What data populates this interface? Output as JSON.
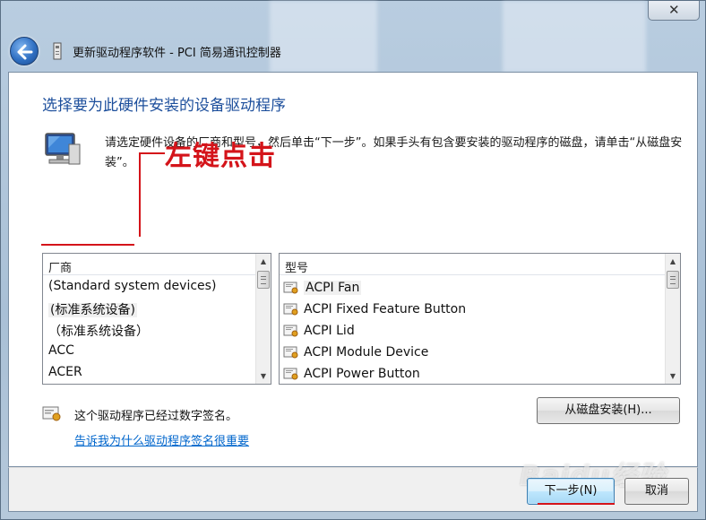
{
  "window": {
    "title": "更新驱动程序软件 - PCI 简易通讯控制器",
    "close_symbol": "✕"
  },
  "page": {
    "heading": "选择要为此硬件安装的设备驱动程序",
    "instruction": "请选定硬件设备的厂商和型号，然后单击“下一步”。如果手头有包含要安装的驱动程序的磁盘，请单击“从磁盘安装”。"
  },
  "annotation": {
    "text": "左键点击",
    "color": "#d4141a"
  },
  "manufacturer_list": {
    "header": "厂商",
    "items": [
      "(Standard system devices)",
      "(标准系统设备)",
      "（标准系统设备）",
      "ACC",
      "ACER"
    ]
  },
  "model_list": {
    "header": "型号",
    "items": [
      "ACPI Fan",
      "ACPI Fixed Feature Button",
      "ACPI Lid",
      "ACPI Module Device",
      "ACPI Power Button"
    ]
  },
  "signature": {
    "status": "这个驱动程序已经过数字签名。",
    "link": "告诉我为什么驱动程序签名很重要"
  },
  "buttons": {
    "have_disk": "从磁盘安装(H)...",
    "next": "下一步(N)",
    "cancel": "取消"
  },
  "watermark": {
    "text": "Baidu经验"
  },
  "colors": {
    "heading": "#1d4f9c",
    "link": "#0066cc",
    "annotation": "#d4141a"
  }
}
